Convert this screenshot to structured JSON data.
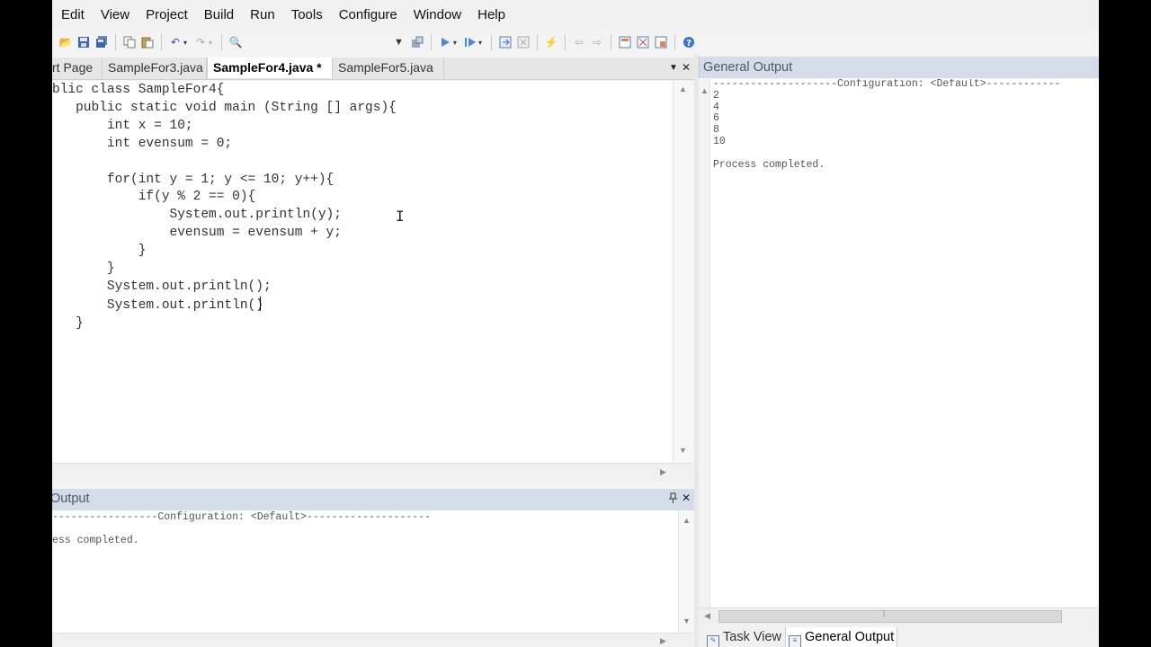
{
  "menu": [
    "Edit",
    "View",
    "Project",
    "Build",
    "Run",
    "Tools",
    "Configure",
    "Window",
    "Help"
  ],
  "editor_tabs": [
    {
      "label": "rt Page",
      "active": false
    },
    {
      "label": "SampleFor3.java",
      "active": false
    },
    {
      "label": "SampleFor4.java *",
      "active": true
    },
    {
      "label": "SampleFor5.java",
      "active": false
    }
  ],
  "code_lines": [
    "blic class SampleFor4{",
    "   public static void main (String [] args){",
    "       int x = 10;",
    "       int evensum = 0;",
    "",
    "       for(int y = 1; y <= 10; y++){",
    "           if(y % 2 == 0){",
    "               System.out.println(y);",
    "               evensum = evensum + y;",
    "           }",
    "       }",
    "       System.out.println();",
    "       System.out.println()",
    "   }"
  ],
  "bottom_output": {
    "title": "Output",
    "lines": [
      "-----------------Configuration: <Default>--------------------",
      "",
      "ess completed."
    ]
  },
  "right_output": {
    "title": "General Output",
    "lines": [
      "--------------------Configuration: <Default>------------",
      "2",
      "4",
      "6",
      "8",
      "10",
      "",
      "Process completed."
    ]
  },
  "bottom_tabs": [
    {
      "label": "Task View",
      "icon": "task-view-icon",
      "active": false
    },
    {
      "label": "General Output",
      "icon": "general-output-icon",
      "active": true
    }
  ],
  "icons": {
    "close": "✕",
    "pin": "📌",
    "dropdown": "▾"
  },
  "colors": {
    "panel_header": "#d3dce8",
    "editor_bg": "#ffffff",
    "app_bg": "#f3f3f3"
  }
}
